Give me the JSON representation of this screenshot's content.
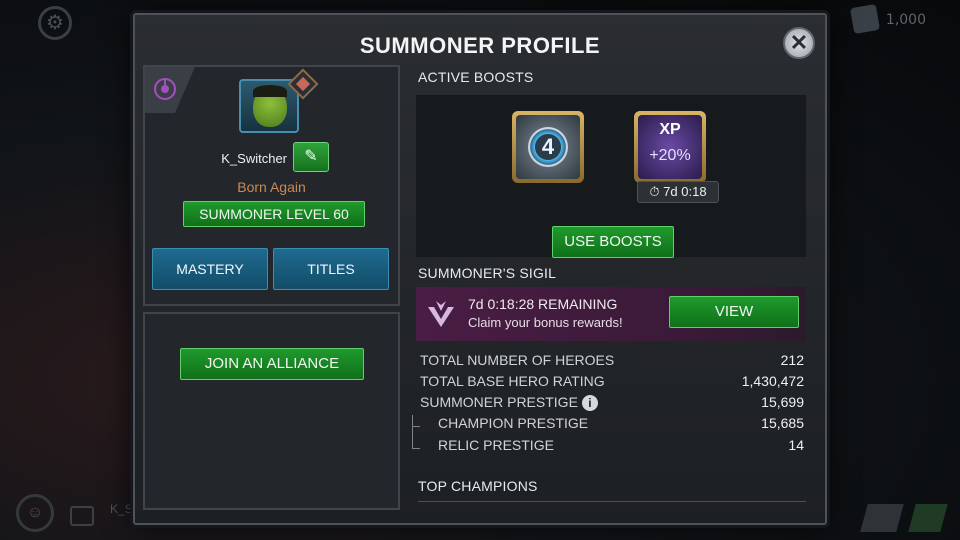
{
  "background": {
    "currency_value": "1,000",
    "chat_name": "K_S"
  },
  "dialog": {
    "title": "SUMMONER PROFILE",
    "close_label": "✕"
  },
  "profile": {
    "username": "K_Switcher",
    "title": "Born Again",
    "level_label": "SUMMONER LEVEL 60",
    "mastery_label": "MASTERY",
    "titles_label": "TITLES",
    "edit_glyph": "✎"
  },
  "alliance": {
    "join_label": "JOIN AN ALLIANCE"
  },
  "boosts": {
    "heading": "ACTIVE BOOSTS",
    "items": [
      {
        "icon": "fantastic-four-boost-icon",
        "glyph": "4"
      },
      {
        "icon": "xp-boost-icon",
        "label": "XP",
        "amount": "+20%"
      }
    ],
    "timer": "⏱ 7d 0:18",
    "use_label": "USE BOOSTS"
  },
  "sigil": {
    "heading": "SUMMONER'S SIGIL",
    "remaining": "7d 0:18:28 REMAINING",
    "claim": "Claim your bonus rewards!",
    "view_label": "VIEW"
  },
  "stats": [
    {
      "label": "TOTAL NUMBER OF HEROES",
      "value": "212"
    },
    {
      "label": "TOTAL BASE HERO RATING",
      "value": "1,430,472"
    },
    {
      "label": "SUMMONER PRESTIGE",
      "value": "15,699",
      "info": "i"
    },
    {
      "label": "CHAMPION PRESTIGE",
      "value": "15,685"
    },
    {
      "label": "RELIC PRESTIGE",
      "value": "14"
    }
  ],
  "top_champions": {
    "heading": "TOP CHAMPIONS"
  },
  "colors": {
    "accent_green": "#1f9a2c",
    "tab_blue": "#1f6b8f",
    "sigil_purple": "#4a1d44",
    "title_orange": "#c98a55"
  }
}
